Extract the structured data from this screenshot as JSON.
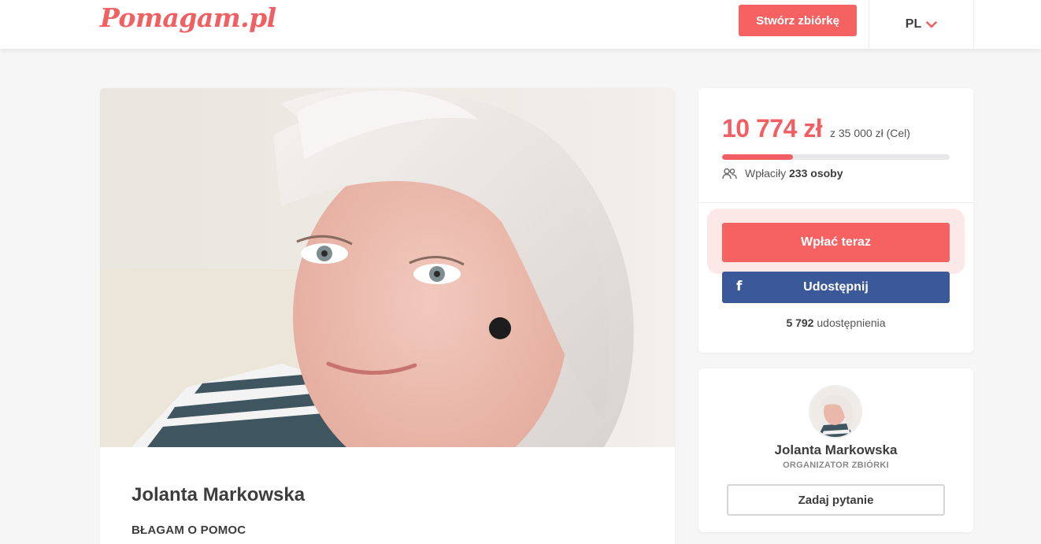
{
  "header": {
    "logo": "Pomagam.pl",
    "create_label": "Stwórz zbiórkę",
    "language": "PL"
  },
  "campaign": {
    "name": "Jolanta Markowska",
    "subtitle": "BŁAGAM O POMOC"
  },
  "donation": {
    "amount": "10 774 zł",
    "goal_text": "z 35 000 zł (Cel)",
    "progress_fraction": 0.31,
    "payers_label": "Wpłaciły",
    "payers_count": "233 osoby",
    "pay_label": "Wpłać teraz",
    "share_label": "Udostępnij",
    "facebook_glyph": "f",
    "shares_count": "5 792",
    "shares_label": "udostępnienia"
  },
  "organizer": {
    "name": "Jolanta Markowska",
    "role": "ORGANIZATOR ZBIÓRKI",
    "ask_label": "Zadaj pytanie"
  },
  "colors": {
    "accent": "#f66262",
    "facebook": "#3b5998",
    "background": "#f6f6f6"
  },
  "icons": {
    "language_chevron": "chevron-down-icon",
    "payers": "users-icon",
    "facebook": "facebook-icon"
  }
}
